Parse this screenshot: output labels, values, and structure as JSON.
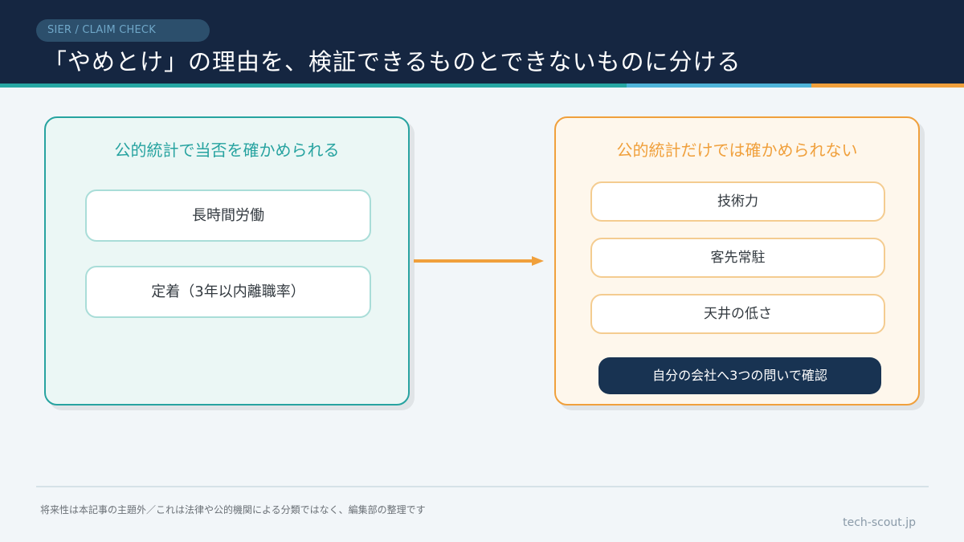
{
  "header": {
    "tag": "SIER / CLAIM CHECK",
    "title": "「やめとけ」の理由を、検証できるものとできないものに分ける"
  },
  "left_panel": {
    "title": "公的統計で当否を確かめられる",
    "items": [
      "長時間労働",
      "定着（3年以内離職率）"
    ]
  },
  "right_panel": {
    "title": "公的統計だけでは確かめられない",
    "items": [
      "技術力",
      "客先常駐",
      "天井の低さ"
    ],
    "cta_label": "自分の会社へ3つの問いで確認"
  },
  "footer": {
    "note": "将来性は本記事の主題外／これは法律や公的機関による分類ではなく、編集部の整理です",
    "site": "tech-scout.jp"
  },
  "colors": {
    "header_bg": "#152641",
    "accent_teal": "#27a3a0",
    "accent_orange": "#f0a03c",
    "cta_bg": "#183352"
  }
}
